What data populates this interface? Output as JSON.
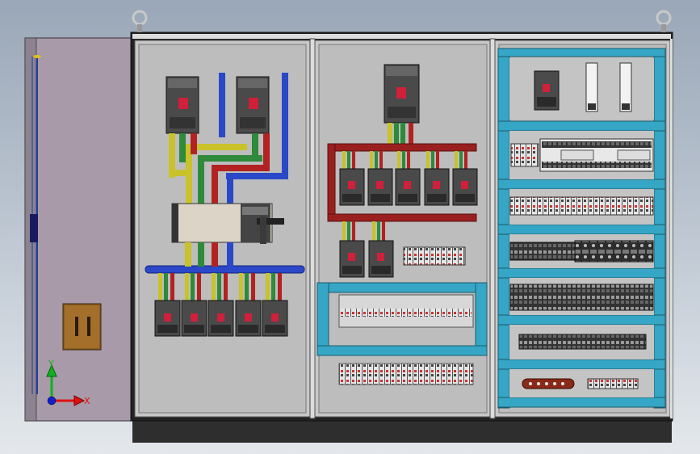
{
  "viewport": {
    "background_top": "#9aa7b8",
    "background_bottom": "#e4e8ec"
  },
  "cabinet": {
    "frame_color": "#222222",
    "panel_color": "#b9b9b9",
    "door_color": "#a89aa8",
    "plinth_color": "#2e2e2e",
    "section_count": 3,
    "lifting_eyes": 2
  },
  "busbars": {
    "phase_colors": {
      "L1": "#c9c22b",
      "L2": "#2f8a3b",
      "L3": "#b22222",
      "N": "#2a48c8"
    }
  },
  "breakers": {
    "body_color": "#4a4a4a",
    "indicator_color": "#d0203a",
    "section1_count": 7,
    "section2_count": 8
  },
  "cable_trunking": {
    "color": "#35a6c6"
  },
  "axis_triad": {
    "x_label": "X",
    "y_label": "Y",
    "x_color": "#e01010",
    "y_color": "#10b020",
    "z_color": "#1020d0"
  }
}
